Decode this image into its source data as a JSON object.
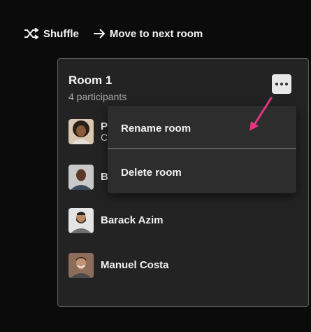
{
  "toolbar": {
    "shuffle_label": "Shuffle",
    "move_label": "Move to next room"
  },
  "room": {
    "title": "Room 1",
    "participant_count": "4 participants",
    "participants": [
      {
        "name": "P",
        "sub": "C",
        "avatar": "woman-with-curly-hair"
      },
      {
        "name": "B",
        "avatar": "man-smiling"
      },
      {
        "name": "Barack Azim",
        "avatar": "man-with-beard"
      },
      {
        "name": "Manuel Costa",
        "avatar": "man-laughing"
      }
    ]
  },
  "menu": {
    "items": [
      {
        "label": "Rename room"
      },
      {
        "label": "Delete room"
      }
    ]
  },
  "colors": {
    "background": "#0b0b0b",
    "card": "#232323",
    "menu": "#2d2d2d",
    "annotation_arrow": "#e0357f"
  }
}
